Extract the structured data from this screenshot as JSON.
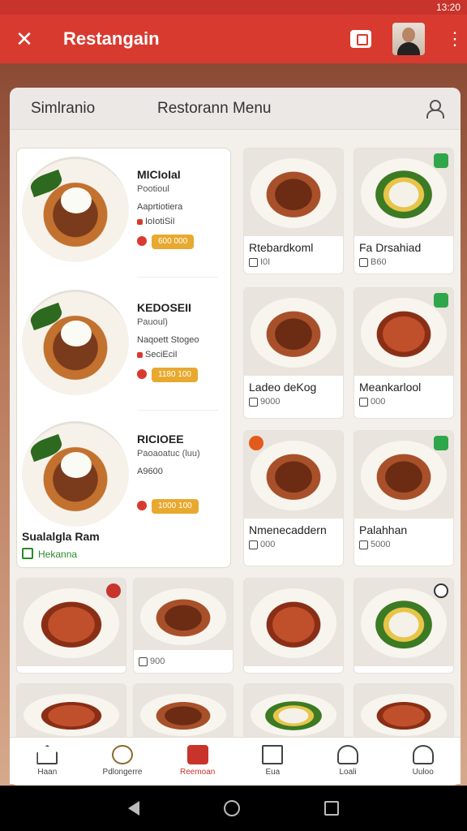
{
  "status_bar": {
    "time": "13:20"
  },
  "app_bar": {
    "title": "Restangain"
  },
  "search": {
    "left_label": "Simlranio",
    "center_label": "Restorann Menu"
  },
  "list_items": [
    {
      "name": "MICIoIaI",
      "sub": "Pootioul",
      "line": "Aaprtiotiera",
      "sub2": "IoIotiSiI",
      "price": "600 000"
    },
    {
      "name": "KEDOSEII",
      "sub": "Pauoul)",
      "line": "Naqoett Stogeo",
      "sub2": "SeciEciI",
      "price": "1180 100"
    },
    {
      "name": "RICIOEE",
      "sub": "Paoaoatuc (luu)",
      "line": "A9600",
      "sub2": "",
      "price": "1000 100"
    }
  ],
  "list_footer": {
    "title": "Sualalgla Ram",
    "subtitle": "Hekanna"
  },
  "grid_cards": [
    {
      "name": "Rtebardkoml",
      "meta": "I0I",
      "badge": ""
    },
    {
      "name": "Fa Drsahiad",
      "meta": "B60",
      "badge": "green"
    },
    {
      "name": "Ladeo deKog",
      "meta": "9000",
      "badge": ""
    },
    {
      "name": "Meankarlool",
      "meta": "000",
      "badge": "green"
    },
    {
      "name": "Nmenecaddern",
      "meta": "000",
      "badge": "orange"
    },
    {
      "name": "Palahhan",
      "meta": "5000",
      "badge": "green"
    },
    {
      "name": "",
      "meta": "",
      "badge": "red"
    },
    {
      "name": "",
      "meta": "900",
      "badge": ""
    },
    {
      "name": "",
      "meta": "",
      "badge": ""
    },
    {
      "name": "",
      "meta": "",
      "badge": "outline"
    }
  ],
  "bottom_nav": [
    {
      "label": "Haan"
    },
    {
      "label": "Pdlongerre"
    },
    {
      "label": "Reemoan"
    },
    {
      "label": "Eua"
    },
    {
      "label": "Loali"
    },
    {
      "label": "Uuloo"
    }
  ]
}
